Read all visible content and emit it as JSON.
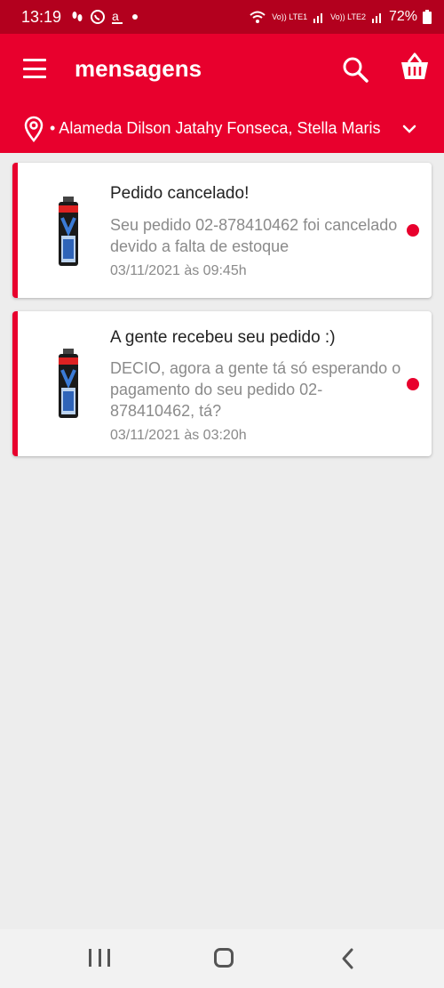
{
  "status_bar": {
    "time": "13:19",
    "notification_icons": [
      "footprints-icon",
      "whatsapp-icon",
      "amazon-icon",
      "dot-icon"
    ],
    "lte1_label": "Vo)) LTE1",
    "lte2_label": "Vo)) LTE2",
    "battery": "72%"
  },
  "app_bar": {
    "title": "mensagens",
    "menu_icon": "hamburger-icon",
    "search_icon": "search-icon",
    "cart_icon": "basket-icon"
  },
  "location": {
    "address": "• Alameda Dilson Jatahy Fonseca, Stella Maris"
  },
  "messages": [
    {
      "title": "Pedido cancelado!",
      "body": "Seu pedido 02-878410462 foi cancelado devido a falta de estoque",
      "date": "03/11/2021 às 09:45h",
      "unread": true
    },
    {
      "title": "A gente recebeu seu pedido :)",
      "body": "DECIO, agora a gente tá só esperando o pagamento do seu pedido 02-878410462, tá?",
      "date": "03/11/2021 às 03:20h",
      "unread": true
    }
  ],
  "colors": {
    "brand": "#e8002d",
    "status_bar": "#b3001e",
    "background": "#ededed",
    "muted_text": "#8a8a8a"
  },
  "nav": {
    "recent_icon": "recent-apps-icon",
    "home_icon": "home-icon",
    "back_icon": "back-icon"
  }
}
